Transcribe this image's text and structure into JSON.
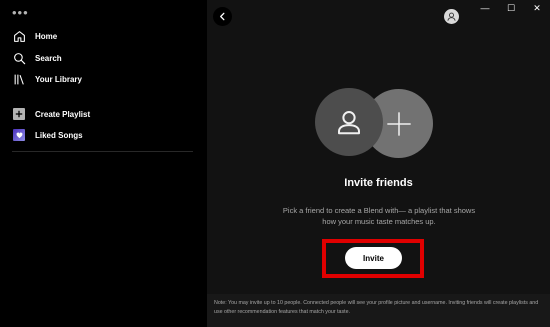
{
  "sidebar": {
    "menu_dots": "•••",
    "nav": [
      {
        "label": "Home",
        "icon": "home-icon"
      },
      {
        "label": "Search",
        "icon": "search-icon"
      },
      {
        "label": "Your Library",
        "icon": "library-icon"
      }
    ],
    "create_playlist": {
      "label": "Create Playlist",
      "icon": "plus-icon"
    },
    "liked_songs": {
      "label": "Liked Songs",
      "icon": "heart-icon",
      "color": "#6b5cd6"
    }
  },
  "window": {
    "minimize": "—",
    "maximize": "☐",
    "close": "✕"
  },
  "main": {
    "title": "Invite friends",
    "description": "Pick a friend to create a Blend with— a playlist that shows how your music taste matches up.",
    "invite_button": "Invite",
    "highlight_color": "#e00000",
    "note": "Note: You may invite up to 10 people. Connected people will see your profile picture and username. Inviting friends will create playlists and use other recommendation features that match your taste."
  }
}
